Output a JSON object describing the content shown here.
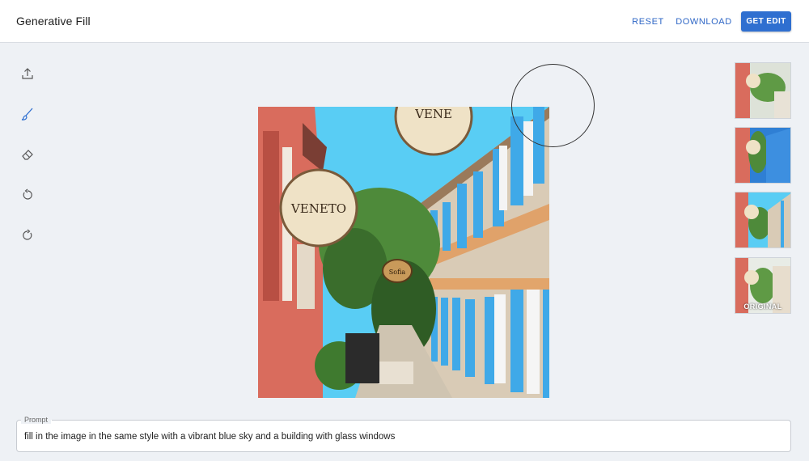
{
  "header": {
    "title": "Generative Fill",
    "reset_label": "RESET",
    "download_label": "DOWNLOAD",
    "get_edit_label": "GET EDIT"
  },
  "colors": {
    "accent": "#2f6fd0",
    "sky": "#59cdf4",
    "shutter_blue": "#3fa9e8",
    "wall_red": "#d96c5d"
  },
  "tools": [
    {
      "name": "upload",
      "icon": "upload-icon"
    },
    {
      "name": "brush",
      "icon": "brush-icon",
      "active": true
    },
    {
      "name": "eraser",
      "icon": "eraser-icon"
    },
    {
      "name": "undo",
      "icon": "undo-icon"
    },
    {
      "name": "redo",
      "icon": "redo-icon"
    }
  ],
  "canvas": {
    "sign_main_text": "VENETO",
    "sign_small_text": "Sofia",
    "sign_top_text": "VENE"
  },
  "thumbnails": [
    {
      "label": ""
    },
    {
      "label": ""
    },
    {
      "label": ""
    },
    {
      "label": "ORIGINAL"
    }
  ],
  "prompt": {
    "legend": "Prompt",
    "value": "fill in the image in the same style with a vibrant blue sky and a building with glass windows"
  }
}
